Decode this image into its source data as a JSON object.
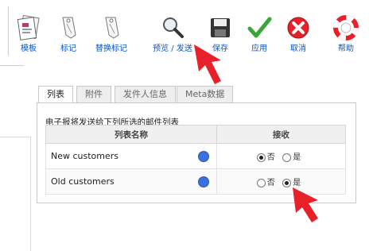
{
  "toolbar": {
    "items": [
      {
        "label": "模板",
        "icon": "template-icon"
      },
      {
        "label": "标记",
        "icon": "tag-icon"
      },
      {
        "label": "替换标记",
        "icon": "replace-tag-icon"
      },
      {
        "label": "预览 / 发送",
        "icon": "magnifier-icon"
      },
      {
        "label": "保存",
        "icon": "save-icon"
      },
      {
        "label": "应用",
        "icon": "check-icon"
      },
      {
        "label": "取消",
        "icon": "cancel-icon"
      },
      {
        "label": "帮助",
        "icon": "help-icon"
      }
    ]
  },
  "tabs": [
    "列表",
    "附件",
    "发件人信息",
    "Meta数据"
  ],
  "panel": {
    "caption": "电子报将发送给下列所选的邮件列表",
    "headers": {
      "list_name": "列表名称",
      "receive": "接收"
    },
    "rows": [
      {
        "name": "New customers",
        "no_label": "否",
        "yes_label": "是",
        "selected": "no"
      },
      {
        "name": "Old customers",
        "no_label": "否",
        "yes_label": "是",
        "selected": "yes"
      }
    ]
  },
  "colors": {
    "link": "#0b55c4",
    "accent_red": "#e8202a",
    "dot_blue": "#3b6fe0"
  }
}
